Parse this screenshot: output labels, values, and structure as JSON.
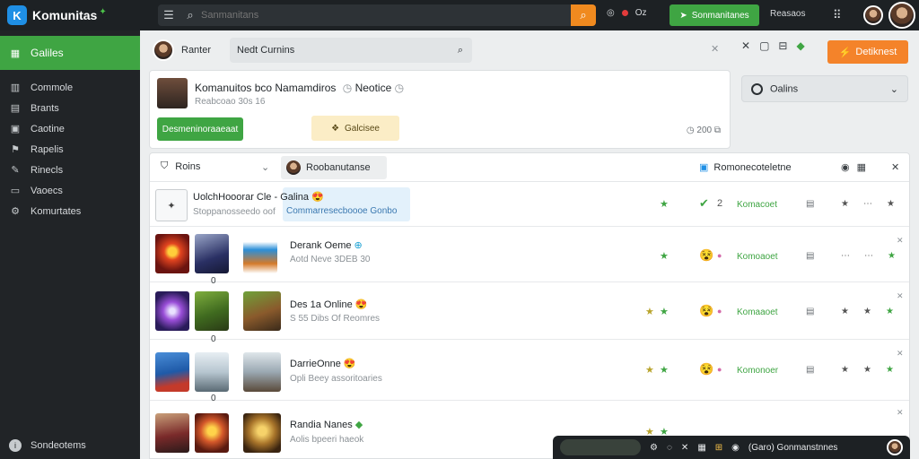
{
  "app": {
    "name": "Komunitas"
  },
  "topbar": {
    "search_placeholder": "Sanmanitans",
    "status_text": "Oz",
    "green_button": "Sonmanitanes",
    "link": "Reasaos"
  },
  "sidebar": {
    "active": {
      "label": "Galiles",
      "icon": "grid-icon"
    },
    "items": [
      {
        "label": "Commole",
        "icon": "book-icon"
      },
      {
        "label": "Brants",
        "icon": "doc-icon"
      },
      {
        "label": "Caotine",
        "icon": "clipboard-icon"
      },
      {
        "label": "Rapelis",
        "icon": "flag-icon"
      },
      {
        "label": "Rinecls",
        "icon": "pen-icon"
      },
      {
        "label": "Vaoecs",
        "icon": "screen-icon"
      },
      {
        "label": "Komurtates",
        "icon": "gear-icon"
      }
    ],
    "bottom": "Sondeotems"
  },
  "tabbar": {
    "profile_label": "Ranter",
    "search_value": "Nedt Curnins",
    "dropdown_label": "Oalins"
  },
  "actions": {
    "orange_button": "Detiknest"
  },
  "info_card": {
    "title": "Komanuitos bco Namamdiros",
    "title_suffix": "Neotice",
    "subtitle": "Reabcoao 30s 16",
    "green_button": "Desmeninoraaeaat",
    "yellow_button": "Galcisee",
    "meta": "200"
  },
  "list": {
    "filter_label": "Roins",
    "chip_label": "Roobanutanse",
    "right_label": "Romonecoteletne",
    "rows": [
      {
        "title": "UolchHooorar Cle - Galina",
        "subtitle": "Stoppanosseedo oof",
        "highlight": "Commarresecboooe Gonbo",
        "status": "Komacoet",
        "check_count": "2",
        "thumb_labels": []
      },
      {
        "title": "Derank Oeme",
        "subtitle": "Aotd Neve 3DEB 30",
        "status": "Komoaoet",
        "thumb_labels": [
          "0"
        ]
      },
      {
        "title": "Des 1a Online",
        "subtitle": "S 55 Dibs Of Reomres",
        "status": "Komaaoet",
        "thumb_labels": [
          "0"
        ]
      },
      {
        "title": "DarrieOnne",
        "subtitle": "Opli Beey assoritoaries",
        "status": "Komonoer",
        "thumb_labels": [
          "0"
        ]
      },
      {
        "title": "Randia Nanes",
        "subtitle": "Aolis bpeeri haeok",
        "status": "",
        "thumb_labels": []
      }
    ]
  },
  "bottom_bar": {
    "label": "(Garo) Gonmanstnnes"
  }
}
